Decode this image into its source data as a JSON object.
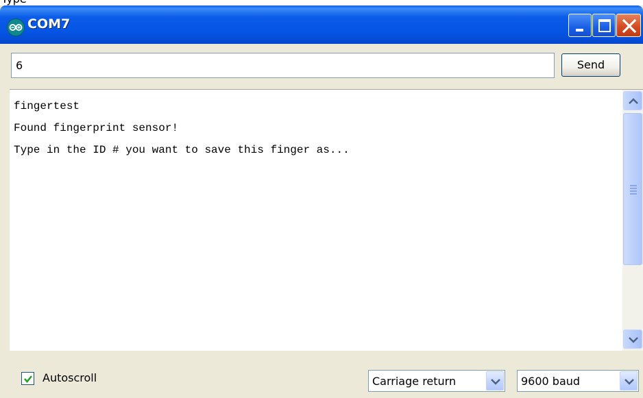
{
  "above_window_text": "Type",
  "window": {
    "title": "COM7",
    "buttons": [
      "minimize",
      "maximize",
      "close"
    ]
  },
  "send_bar": {
    "input_value": "6",
    "send_label": "Send"
  },
  "output_lines": [
    "fingertest",
    "Found fingerprint sensor!",
    "Type in the ID # you want to save this finger as..."
  ],
  "statusbar": {
    "autoscroll_label": "Autoscroll",
    "autoscroll_checked": true,
    "line_ending": "Carriage return",
    "baud_rate": "9600 baud"
  },
  "colors": {
    "titlebar": "#0554e3",
    "close_button": "#d3491f",
    "window_bg": "#ece9d8"
  }
}
